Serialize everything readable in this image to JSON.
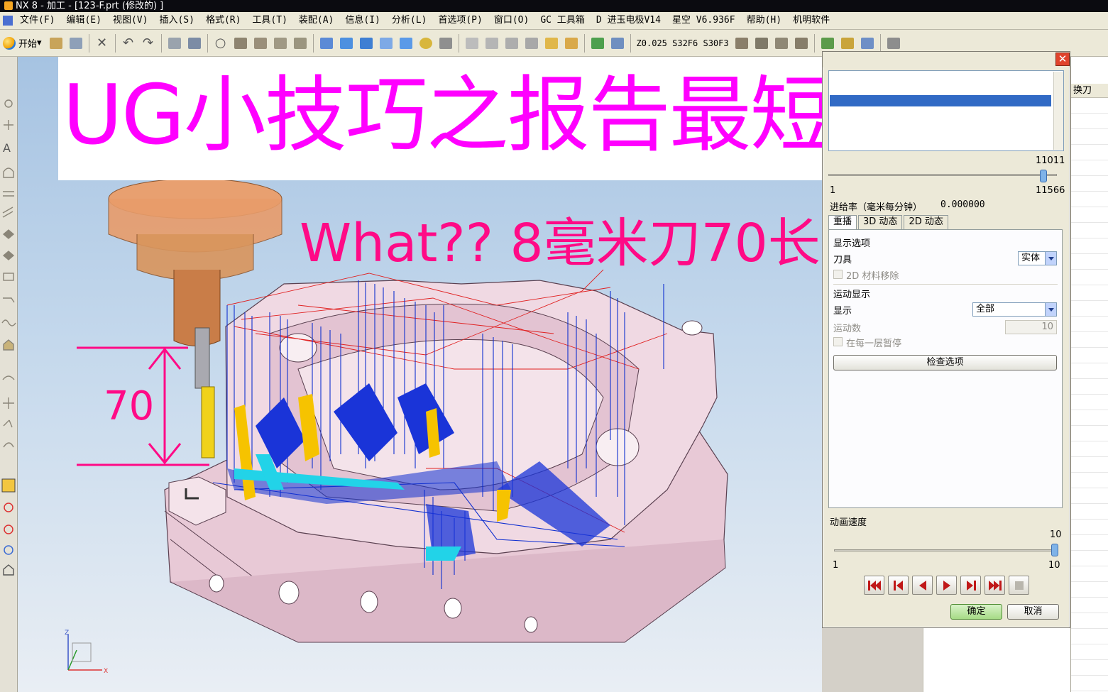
{
  "window": {
    "title": "NX 8 - 加工 - [123-F.prt  (修改的) ]"
  },
  "menubar": {
    "items": [
      "文件(F)",
      "编辑(E)",
      "视图(V)",
      "插入(S)",
      "格式(R)",
      "工具(T)",
      "装配(A)",
      "信息(I)",
      "分析(L)",
      "首选项(P)",
      "窗口(O)",
      "GC 工具箱",
      "D 进玉电极V14",
      "星空 V6.936F",
      "帮助(H)",
      "机明软件"
    ]
  },
  "toolbar": {
    "start_label": "开始",
    "feed_readout": "Z0.025 S32F6 S30F3"
  },
  "banner": {
    "title": "UG小技巧之报告最短刀具",
    "annotation": "What?? 8毫米刀70长!",
    "dimension": "70"
  },
  "dialog": {
    "slider_max_value": "11011",
    "slider_left_label": "1",
    "slider_right_label": "11566",
    "feed_label": "进给率（毫米每分钟）",
    "feed_value": "0.000000",
    "tabs": [
      "重播",
      "3D 动态",
      "2D 动态"
    ],
    "active_tab": "重播",
    "display_options_label": "显示选项",
    "tool_label": "刀具",
    "tool_value": "实体",
    "material_removal_label": "2D 材料移除",
    "motion_display_label": "运动显示",
    "display_label": "显示",
    "display_value": "全部",
    "motion_count_label": "运动数",
    "motion_count_value": "10",
    "pause_each_layer_label": "在每一层暂停",
    "check_options_label": "检查选项",
    "anim_speed_label": "动画速度",
    "anim_speed_value": "10",
    "anim_min": "1",
    "anim_max": "10",
    "ok_label": "确定",
    "cancel_label": "取消"
  },
  "navigator": {
    "column_header": "换刀"
  },
  "colors": {
    "banner_text": "#ff00ff",
    "annotation_text": "#ff0a86",
    "part_body": "#e8c9d6",
    "toolpath_cut": "#1030d0",
    "toolpath_rapid": "#e02020",
    "tool_shank": "#d9954f"
  }
}
